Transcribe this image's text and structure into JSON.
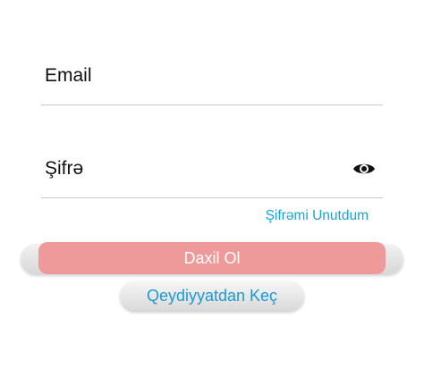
{
  "login_form": {
    "email": {
      "placeholder": "Email",
      "value": ""
    },
    "password": {
      "placeholder": "Şifrə",
      "value": "",
      "toggle_icon": "eye-icon"
    },
    "forgot_password_label": "Şifrəmi Unutdum",
    "login_label": "Daxil Ol",
    "register_label": "Qeydiyyatdan Keç"
  },
  "colors": {
    "accent_link": "#1aa3d6",
    "login_button": "#ee9a9a",
    "divider": "#c9c9c9"
  }
}
